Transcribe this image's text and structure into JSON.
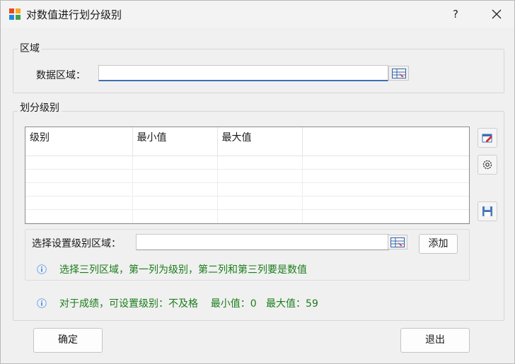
{
  "window": {
    "title": "对数值进行划分级别",
    "help_label": "?"
  },
  "region_group": {
    "title": "区域",
    "data_range_label": "数据区域：",
    "data_range_value": ""
  },
  "level_group": {
    "title": "划分级别",
    "columns": [
      "级别",
      "最小值",
      "最大值",
      ""
    ],
    "rows": [
      [
        "",
        "",
        "",
        ""
      ],
      [
        "",
        "",
        "",
        ""
      ],
      [
        "",
        "",
        "",
        ""
      ],
      [
        "",
        "",
        "",
        ""
      ],
      [
        "",
        "",
        "",
        ""
      ]
    ],
    "select_range_label": "选择设置级别区域：",
    "select_range_value": "",
    "add_label": "添加",
    "hint": "选择三列区域，第一列为级别，第二列和第三列要是数值"
  },
  "score_info": "对于成绩，可设置级别：不及格    最小值：0   最大值：59",
  "footer": {
    "ok_label": "确定",
    "exit_label": "退出"
  },
  "colors": {
    "hint_green": "#1b7d1b",
    "focus_blue": "#3c6fb4"
  }
}
